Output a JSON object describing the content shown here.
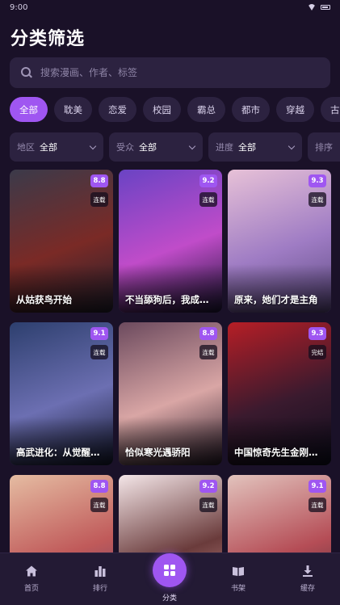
{
  "status_bar": {
    "time": "9:00"
  },
  "page_title": "分类筛选",
  "search": {
    "placeholder": "搜索漫画、作者、标签",
    "value": ""
  },
  "categories": [
    "全部",
    "耽美",
    "恋爱",
    "校园",
    "霸总",
    "都市",
    "穿越",
    "古风"
  ],
  "active_category": "全部",
  "filters": [
    {
      "label": "地区",
      "value": "全部"
    },
    {
      "label": "受众",
      "value": "全部"
    },
    {
      "label": "进度",
      "value": "全部"
    },
    {
      "label": "排序",
      "value": ""
    }
  ],
  "comics": [
    {
      "title": "从姑获鸟开始",
      "score": "8.8",
      "status": "连载",
      "colors": [
        "#3b3a4a",
        "#7a2a26",
        "#23202e"
      ]
    },
    {
      "title": "不当舔狗后，我成了...",
      "score": "9.2",
      "status": "连载",
      "colors": [
        "#6a43c4",
        "#c04cc9",
        "#1d1638"
      ]
    },
    {
      "title": "原来，她们才是主角",
      "score": "9.3",
      "status": "连载",
      "colors": [
        "#e7c1d7",
        "#9f7cc4",
        "#5d4a82"
      ]
    },
    {
      "title": "高武进化：从觉醒怪...",
      "score": "9.1",
      "status": "连载",
      "colors": [
        "#2d3f6e",
        "#6c6fb2",
        "#14182e"
      ]
    },
    {
      "title": "恰似寒光遇骄阳",
      "score": "8.8",
      "status": "连载",
      "colors": [
        "#6c4a5e",
        "#d9a6a5",
        "#2a1c2a"
      ]
    },
    {
      "title": "中国惊奇先生金刚师篇",
      "score": "9.3",
      "status": "完结",
      "colors": [
        "#b61e26",
        "#3a1a2e",
        "#0e0d1e"
      ]
    },
    {
      "title": "",
      "score": "8.8",
      "status": "连载",
      "colors": [
        "#e5bca2",
        "#c05a5a",
        "#5c3e66"
      ]
    },
    {
      "title": "",
      "score": "9.2",
      "status": "连载",
      "colors": [
        "#f4e6e8",
        "#6a3b3b",
        "#d79c9c"
      ]
    },
    {
      "title": "",
      "score": "9.1",
      "status": "连载",
      "colors": [
        "#e2c3bd",
        "#b54d56",
        "#3b2a35"
      ]
    }
  ],
  "bottom_nav": [
    {
      "label": "首页",
      "icon": "home-icon"
    },
    {
      "label": "排行",
      "icon": "ranking-icon"
    },
    {
      "label": "分类",
      "icon": "category-icon",
      "active": true
    },
    {
      "label": "书架",
      "icon": "bookshelf-icon"
    },
    {
      "label": "缓存",
      "icon": "download-icon"
    }
  ],
  "colors": {
    "accent": "#9f56f1",
    "background": "#1a1128",
    "surface": "#2c2240"
  }
}
